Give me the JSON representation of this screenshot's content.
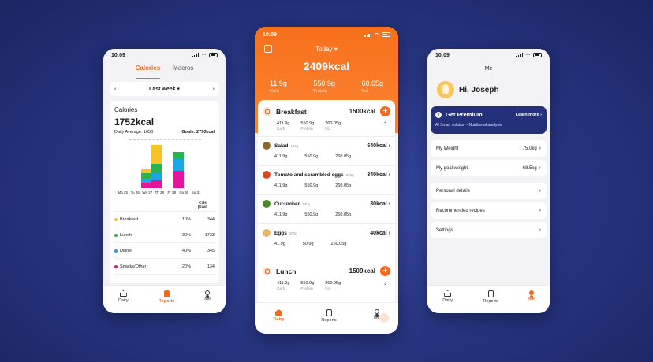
{
  "colors": {
    "accent": "#f26a1b",
    "breakfast": "#f7c325",
    "lunch": "#29b34a",
    "dinner": "#1ea5e6",
    "snacks": "#e6139b",
    "premium": "#24307a"
  },
  "status_time": "10:09",
  "reports": {
    "tabs": [
      "Calories",
      "Macros"
    ],
    "period": {
      "prev": "‹",
      "label": "Last week",
      "caret": "▾",
      "next": "›"
    },
    "card_title": "Calories",
    "total": "1752kcal",
    "daily_average": "Daily Average: 1653",
    "goals": "Goals: 2790kcal",
    "days": [
      "Mo 25",
      "Tu 26",
      "We 27",
      "Th 28",
      "Fr 29",
      "Sa 30",
      "Su 31"
    ],
    "col_header": "Cals\n(Kcal)",
    "rows": [
      {
        "name": "Breakfast",
        "pct": "10%",
        "kcal": "344",
        "color": "#f7c325"
      },
      {
        "name": "Lunch",
        "pct": "30%",
        "kcal": "1733",
        "color": "#29b34a"
      },
      {
        "name": "Dinner",
        "pct": "40%",
        "kcal": "345",
        "color": "#1ea5e6"
      },
      {
        "name": "Snacks/Other",
        "pct": "20%",
        "kcal": "134",
        "color": "#e6139b"
      }
    ]
  },
  "chart_data": {
    "type": "bar",
    "stacked": true,
    "categories": [
      "Mo 25",
      "Tu 26",
      "We 27",
      "Th 28",
      "Fr 29",
      "Sa 30",
      "Su 31"
    ],
    "series": [
      {
        "name": "Breakfast",
        "values": [
          0,
          150,
          720,
          0,
          0,
          0,
          0
        ]
      },
      {
        "name": "Lunch",
        "values": [
          0,
          200,
          390,
          0,
          280,
          0,
          0
        ]
      },
      {
        "name": "Dinner",
        "values": [
          0,
          150,
          250,
          0,
          470,
          0,
          0
        ]
      },
      {
        "name": "Snacks/Other",
        "values": [
          0,
          230,
          320,
          0,
          660,
          0,
          0
        ]
      }
    ],
    "ylim": [
      0,
      1900
    ]
  },
  "tabbar": {
    "dairy": "Dairy",
    "reports": "Reports",
    "me": "Me"
  },
  "diary": {
    "date_label": "Today",
    "date_caret": "▾",
    "total": "2409kcal",
    "macros": [
      {
        "value": "11.9g",
        "label": "Carb"
      },
      {
        "value": "550.9g",
        "label": "Protein"
      },
      {
        "value": "60.05g",
        "label": "Fat"
      }
    ],
    "breakfast": {
      "name": "Breakfast",
      "kcal": "1500kcal",
      "plus": "+",
      "macros": [
        {
          "value": "411.9g",
          "label": "Carb"
        },
        {
          "value": "550.9g",
          "label": "Protein"
        },
        {
          "value": "260.05g",
          "label": "Fat"
        }
      ],
      "chevron": "⌃",
      "foods": [
        {
          "name": "Salad",
          "qty": "150g",
          "kcal": "640kcal",
          "m": [
            "411.9g",
            "550.9g",
            "260.05g"
          ],
          "color": "#8a6a2c"
        },
        {
          "name": "Tomato and scrambled eggs",
          "qty": "200g",
          "kcal": "340kcal",
          "m": [
            "411.9g",
            "550.9g",
            "260.05g"
          ],
          "color": "#d9461f"
        },
        {
          "name": "Cucumber",
          "qty": "200g",
          "kcal": "30kcal",
          "m": [
            "411.9g",
            "550.9g",
            "260.05g"
          ],
          "color": "#4d8a2a"
        },
        {
          "name": "Eggs",
          "qty": "200g",
          "kcal": "40kcal",
          "m": [
            "41.9g",
            "50.9g",
            "260.05g"
          ],
          "color": "#e5b66a"
        }
      ]
    },
    "lunch": {
      "name": "Lunch",
      "kcal": "1509kcal",
      "plus": "+",
      "macros": [
        {
          "value": "411.9g",
          "label": "Carb"
        },
        {
          "value": "550.9g",
          "label": "Protein"
        },
        {
          "value": "260.05g",
          "label": "Fat"
        }
      ],
      "chevron": "⌄"
    }
  },
  "me": {
    "title": "Me",
    "greeting": "Hi, Joseph",
    "premium": {
      "badge": "V",
      "title": "Get Premium",
      "cta": "Learn more ›",
      "subtitle": "AI Smart solution - Nutritional analysis"
    },
    "items": [
      {
        "label": "My Weight",
        "value": "75.0kg"
      },
      {
        "label": "My goal weight",
        "value": "68.5kg"
      },
      {
        "label": "Personal details",
        "value": ""
      },
      {
        "label": "Recommended recipes",
        "value": ""
      },
      {
        "label": "Settings",
        "value": ""
      }
    ],
    "chevron": "›"
  }
}
